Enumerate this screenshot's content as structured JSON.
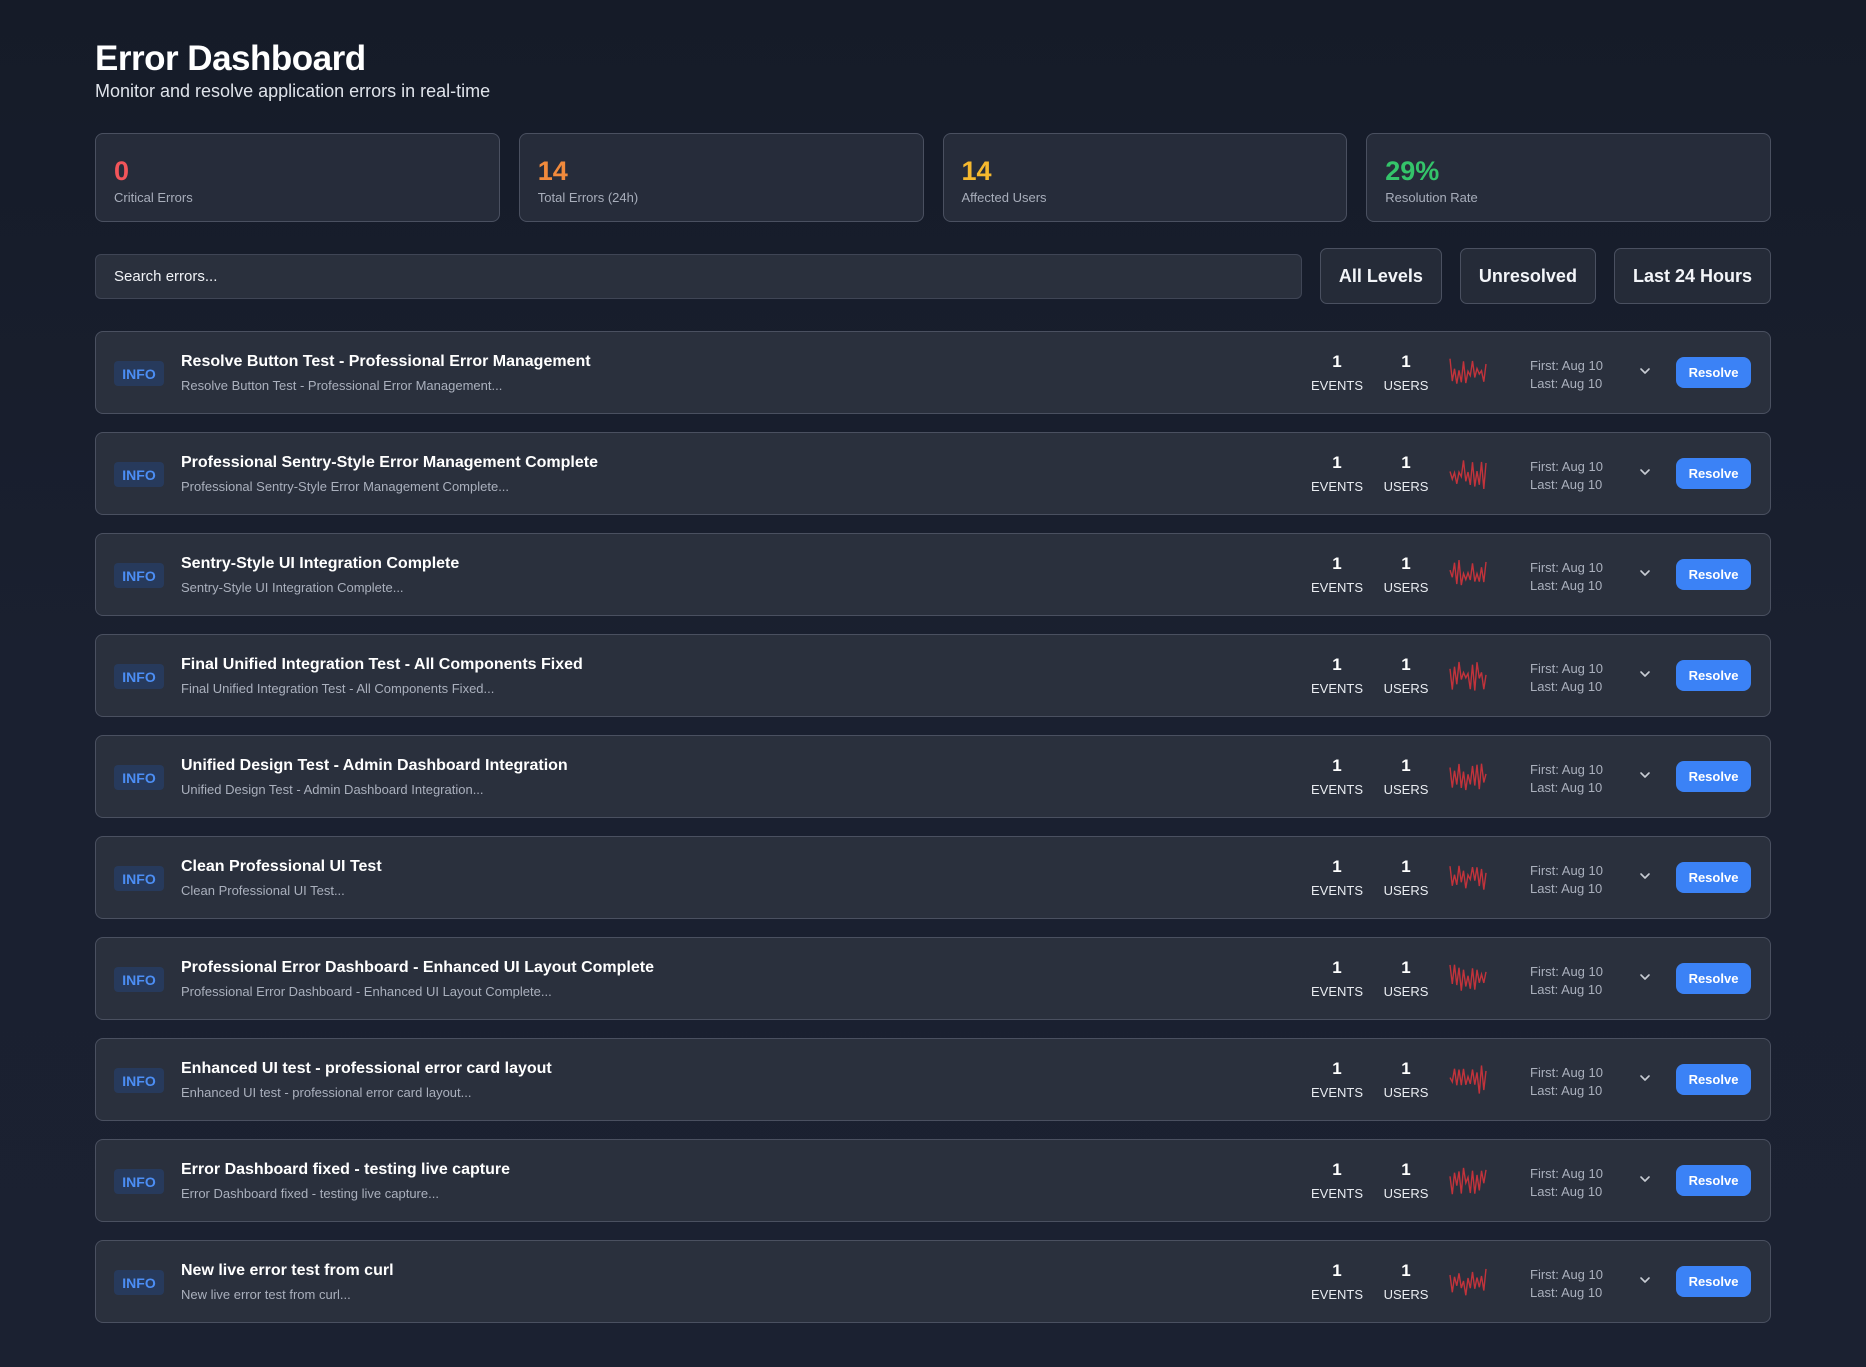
{
  "header": {
    "title": "Error Dashboard",
    "subtitle": "Monitor and resolve application errors in real-time"
  },
  "stats": [
    {
      "value": "0",
      "label": "Critical Errors",
      "color": "#f2555a"
    },
    {
      "value": "14",
      "label": "Total Errors (24h)",
      "color": "#f18a3c"
    },
    {
      "value": "14",
      "label": "Affected Users",
      "color": "#f5b82e"
    },
    {
      "value": "29%",
      "label": "Resolution Rate",
      "color": "#34c46a"
    }
  ],
  "search": {
    "placeholder": "Search errors..."
  },
  "filters": {
    "level": "All Levels",
    "status": "Unresolved",
    "range": "Last 24 Hours"
  },
  "labels": {
    "events": "EVENTS",
    "users": "USERS",
    "resolve": "Resolve"
  },
  "colors": {
    "accent": "#3b82f6",
    "info_badge": "#4c8ef5",
    "sparkline": "#c2333b"
  },
  "errors": [
    {
      "level": "INFO",
      "title": "Resolve Button Test - Professional Error Management",
      "desc": "Resolve Button Test - Professional Error Management...",
      "events": "1",
      "users": "1",
      "first": "First: Aug 10",
      "last": "Last: Aug 10"
    },
    {
      "level": "INFO",
      "title": "Professional Sentry-Style Error Management Complete",
      "desc": "Professional Sentry-Style Error Management Complete...",
      "events": "1",
      "users": "1",
      "first": "First: Aug 10",
      "last": "Last: Aug 10"
    },
    {
      "level": "INFO",
      "title": "Sentry-Style UI Integration Complete",
      "desc": "Sentry-Style UI Integration Complete...",
      "events": "1",
      "users": "1",
      "first": "First: Aug 10",
      "last": "Last: Aug 10"
    },
    {
      "level": "INFO",
      "title": "Final Unified Integration Test - All Components Fixed",
      "desc": "Final Unified Integration Test - All Components Fixed...",
      "events": "1",
      "users": "1",
      "first": "First: Aug 10",
      "last": "Last: Aug 10"
    },
    {
      "level": "INFO",
      "title": "Unified Design Test - Admin Dashboard Integration",
      "desc": "Unified Design Test - Admin Dashboard Integration...",
      "events": "1",
      "users": "1",
      "first": "First: Aug 10",
      "last": "Last: Aug 10"
    },
    {
      "level": "INFO",
      "title": "Clean Professional UI Test",
      "desc": "Clean Professional UI Test...",
      "events": "1",
      "users": "1",
      "first": "First: Aug 10",
      "last": "Last: Aug 10"
    },
    {
      "level": "INFO",
      "title": "Professional Error Dashboard - Enhanced UI Layout Complete",
      "desc": "Professional Error Dashboard - Enhanced UI Layout Complete...",
      "events": "1",
      "users": "1",
      "first": "First: Aug 10",
      "last": "Last: Aug 10"
    },
    {
      "level": "INFO",
      "title": "Enhanced UI test - professional error card layout",
      "desc": "Enhanced UI test - professional error card layout...",
      "events": "1",
      "users": "1",
      "first": "First: Aug 10",
      "last": "Last: Aug 10"
    },
    {
      "level": "INFO",
      "title": "Error Dashboard fixed - testing live capture",
      "desc": "Error Dashboard fixed - testing live capture...",
      "events": "1",
      "users": "1",
      "first": "First: Aug 10",
      "last": "Last: Aug 10"
    },
    {
      "level": "INFO",
      "title": "New live error test from curl",
      "desc": "New live error test from curl...",
      "events": "1",
      "users": "1",
      "first": "First: Aug 10",
      "last": "Last: Aug 10"
    }
  ]
}
